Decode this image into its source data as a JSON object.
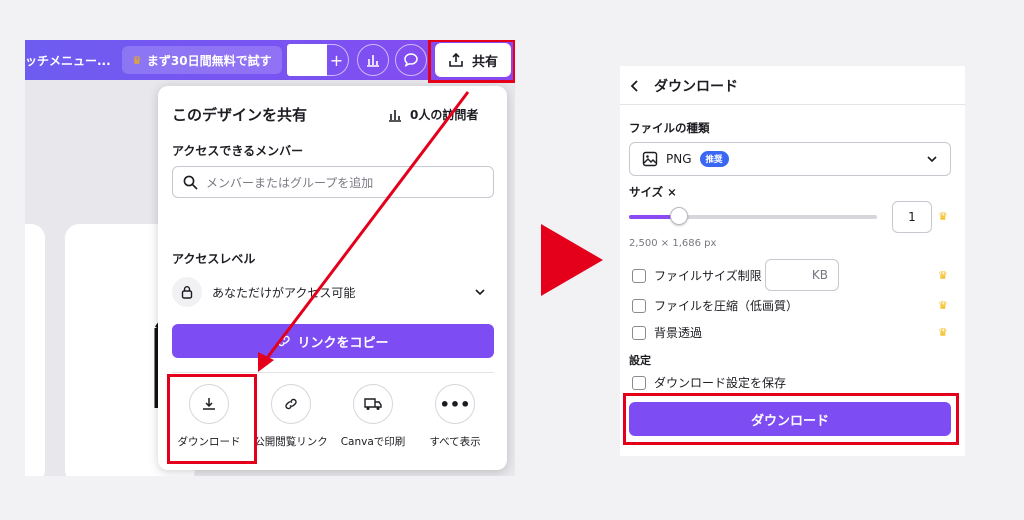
{
  "left": {
    "topbar": {
      "menu_text": "ッチメニュー...",
      "trial_button": "まず30日間無料で試す",
      "share_button": "共有"
    },
    "share_panel": {
      "title": "このデザインを共有",
      "visitors": "0人の訪問者",
      "access_label": "アクセスできるメンバー",
      "search_placeholder": "メンバーまたはグループを追加",
      "access_level_label": "アクセスレベル",
      "access_level_value": "あなただけがアクセス可能",
      "copy_link_button": "リンクをコピー",
      "options": [
        {
          "label": "ダウンロード",
          "icon": "download-icon"
        },
        {
          "label": "公開閲覧リンク",
          "icon": "link-icon"
        },
        {
          "label": "Canvaで印刷",
          "icon": "truck-icon"
        },
        {
          "label": "すべて表示",
          "icon": "more-icon"
        }
      ]
    },
    "canvas_text": "お"
  },
  "right": {
    "header": "ダウンロード",
    "file_type_label": "ファイルの種類",
    "file_type_value": "PNG",
    "file_type_badge": "推奨",
    "size_label": "サイズ ×",
    "size_scale": "1",
    "size_slider_fraction": 0.2,
    "dimensions": "2,500 × 1,686 px",
    "checkbox_size_limit": "ファイルサイズ制限",
    "kb_unit": "KB",
    "checkbox_compress": "ファイルを圧縮（低画質）",
    "checkbox_transparent": "背景透過",
    "settings_label": "設定",
    "checkbox_save_settings": "ダウンロード設定を保存",
    "download_button": "ダウンロード"
  },
  "colors": {
    "accent_purple": "#7d4cf2",
    "highlight_red": "#e4001b",
    "badge_blue": "#3a68f5",
    "crown_gold": "#f5b300"
  }
}
